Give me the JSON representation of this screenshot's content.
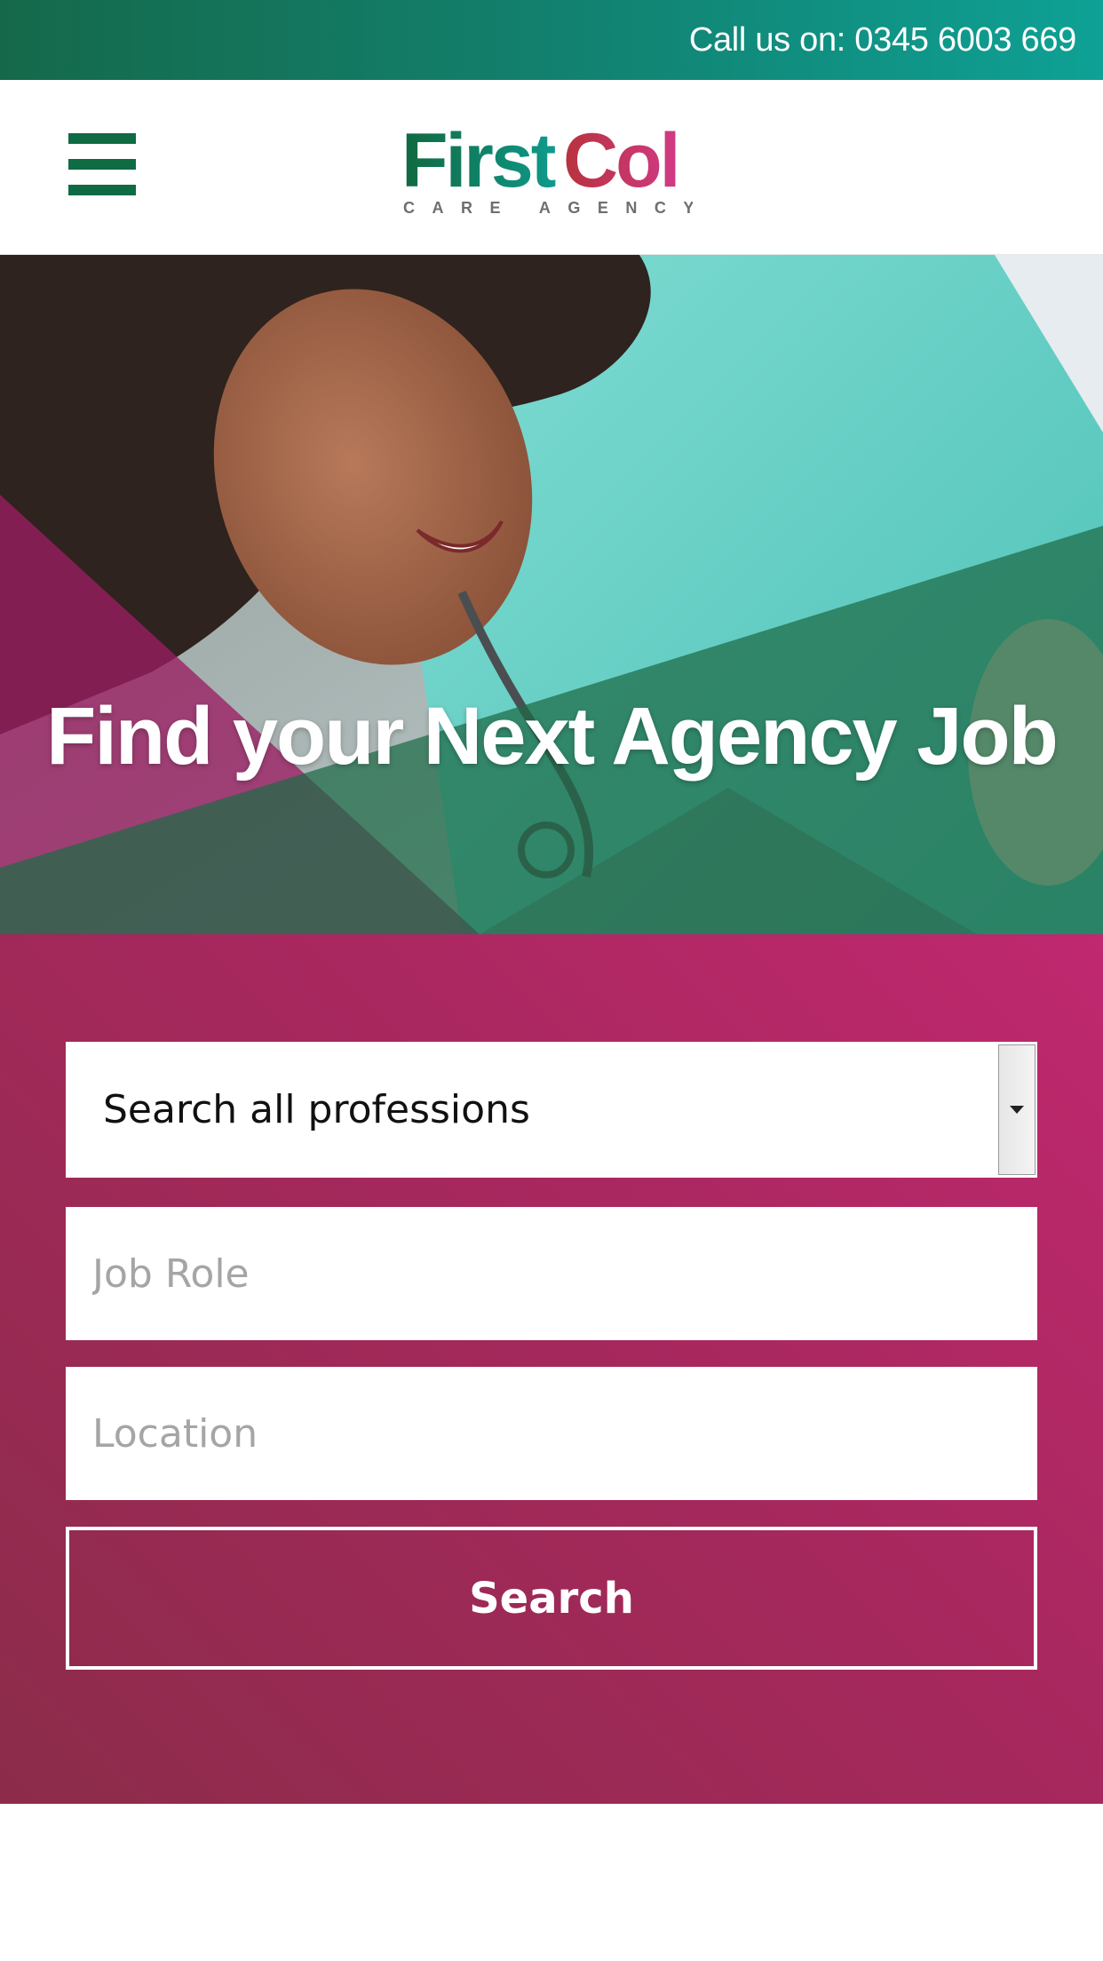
{
  "topbar": {
    "phone_text": "Call us on: 0345 6003 669"
  },
  "header": {
    "logo_first": "First",
    "logo_col": "Col",
    "logo_tagline": "CARE AGENCY"
  },
  "hero": {
    "title": "Find your Next Agency Job"
  },
  "search": {
    "profession_selected": "Search all professions",
    "job_role_placeholder": "Job Role",
    "location_placeholder": "Location",
    "button_label": "Search"
  },
  "colors": {
    "brand_green": "#0f6b44",
    "brand_teal": "#0ea195",
    "brand_magenta": "#c0286f",
    "brand_crimson": "#8c2c4a"
  }
}
